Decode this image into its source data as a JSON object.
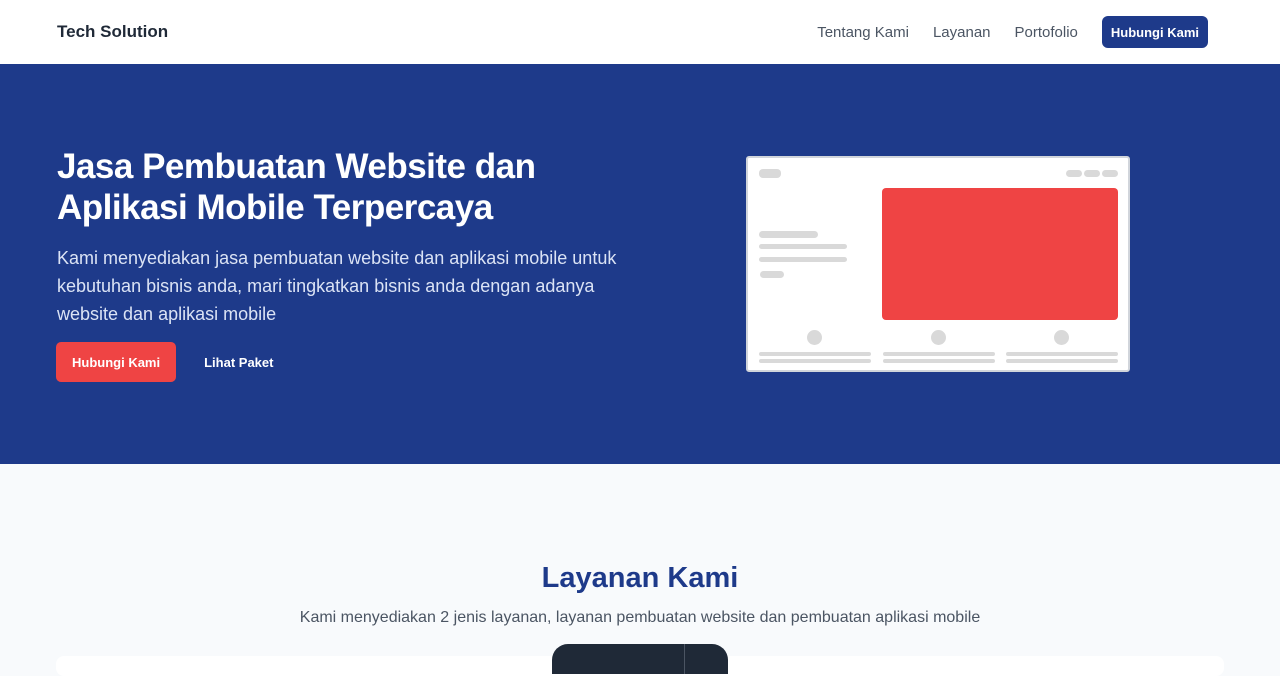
{
  "nav": {
    "brand": "Tech Solution",
    "links": [
      {
        "label": "Tentang Kami"
      },
      {
        "label": "Layanan"
      },
      {
        "label": "Portofolio"
      }
    ],
    "cta_label": "Hubungi Kami"
  },
  "hero": {
    "title": "Jasa Pembuatan Website dan Aplikasi Mobile Terpercaya",
    "description": "Kami menyediakan jasa pembuatan website dan aplikasi mobile untuk kebutuhan bisnis anda, mari tingkatkan bisnis anda dengan adanya website dan aplikasi mobile",
    "primary_button": "Hubungi Kami",
    "secondary_link": "Lihat Paket",
    "illustration_icon": "website-wireframe-illustration"
  },
  "services": {
    "title": "Layanan Kami",
    "description": "Kami menyediakan 2 jenis layanan, layanan pembuatan website dan pembuatan aplikasi mobile"
  },
  "colors": {
    "primary": "#1e3a8a",
    "accent": "#ef4444",
    "background": "#f8fafc"
  }
}
